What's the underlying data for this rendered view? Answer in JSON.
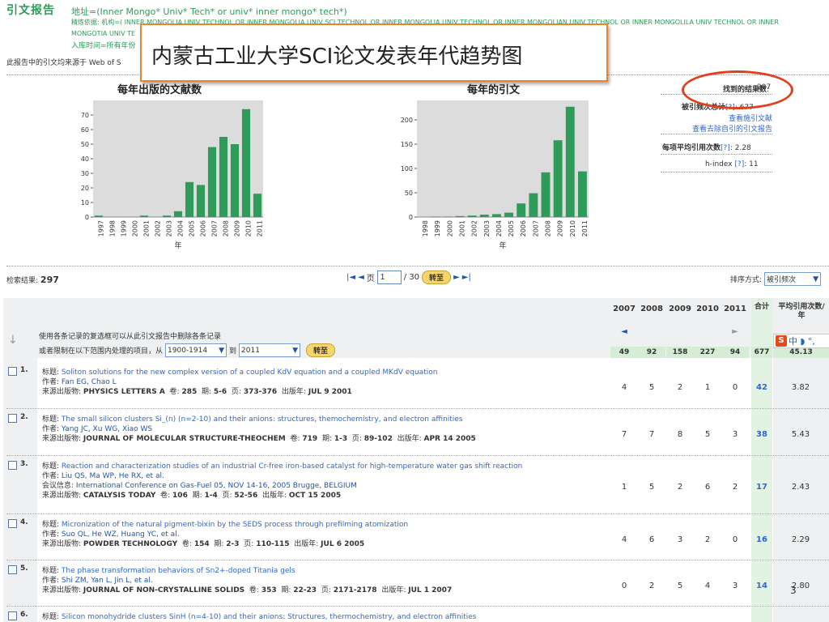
{
  "header": {
    "title": "引文报告",
    "query": "地址=(Inner Mongo* Univ* Tech* or univ* inner mongo* tech*)",
    "refine": "精炼依据: 机构=( INNER MONGOLIA UNIV TECHNOL OR INNER MONGOLIA UNIV SCI TECHNOL OR INNER MONGOLIA UNIV TECHNOL OR INNER MONGOLIAN UNIV TECHNOL OR INNER MONGOLILA UNIV TECHNOL OR INNER",
    "refine2": "MONGOTIA UNIV TE",
    "db": "入库时间=所有年份",
    "source": "此报告中的引文均来源于 Web of S"
  },
  "overlay": {
    "text": "内蒙古工业大学SCI论文发表年代趋势图"
  },
  "chart_data": [
    {
      "type": "bar",
      "title": "每年出版的文献数",
      "xlabel": "年",
      "ylabel": "",
      "categories": [
        "1997",
        "1998",
        "1999",
        "2000",
        "2001",
        "2002",
        "2003",
        "2004",
        "2005",
        "2006",
        "2007",
        "2008",
        "2009",
        "2010",
        "2011"
      ],
      "values": [
        1,
        0,
        0,
        0,
        1,
        0,
        1,
        4,
        24,
        22,
        48,
        55,
        50,
        74,
        16
      ],
      "ylim": [
        0,
        80
      ],
      "yticks": [
        0,
        10,
        20,
        30,
        40,
        50,
        60,
        70
      ],
      "grid": false,
      "color": "#2e9b5b"
    },
    {
      "type": "bar",
      "title": "每年的引文",
      "xlabel": "年",
      "ylabel": "",
      "categories": [
        "1998",
        "1999",
        "2000",
        "2001",
        "2002",
        "2003",
        "2004",
        "2005",
        "2006",
        "2007",
        "2008",
        "2009",
        "2010",
        "2011"
      ],
      "values": [
        0,
        1,
        1,
        2,
        3,
        5,
        6,
        9,
        28,
        49,
        92,
        158,
        227,
        94
      ],
      "ylim": [
        0,
        240
      ],
      "yticks": [
        0,
        50,
        100,
        150,
        200
      ],
      "grid": false,
      "color": "#2e9b5b"
    }
  ],
  "stats": {
    "found_label": "找到的结果数",
    "found_value": "297",
    "cited_label": "被引频次总计",
    "help": "[?]",
    "cited_value": "677",
    "view_citing": "查看施引文献",
    "view_no_self": "查看去除自引的引文报告",
    "avg_label": "每项平均引用次数",
    "avg_value": "2.28",
    "hindex_label": "h-index",
    "hindex_value": "11"
  },
  "toolbar": {
    "results_label": "检索结果:",
    "results_value": "297",
    "page_label": "页",
    "page_value": "1",
    "page_total": "/ 30",
    "go_label": "转至",
    "sort_label": "排序方式:",
    "sort_value": "被引频次"
  },
  "table": {
    "instruction1": "使用各条记录的复选框可以从此引文报告中删除各条记录",
    "instruction2_pre": "或者限制在以下范围内处理的项目，从",
    "range_from": "1900-1914",
    "range_to_label": "到",
    "range_to": "2011",
    "go_label": "转至",
    "years": [
      "2007",
      "2008",
      "2009",
      "2010",
      "2011"
    ],
    "total_label": "合计",
    "avg_label": "平均引用次数/年",
    "year_totals": [
      "49",
      "92",
      "158",
      "227",
      "94"
    ],
    "grand_total": "677",
    "grand_avg": "45.13",
    "prev_arrow": "◄",
    "next_arrow": "►"
  },
  "labels": {
    "title": "标题:",
    "author": "作者:",
    "source": "来源出版物:",
    "volume": "卷:",
    "issue": "期:",
    "pages": "页:",
    "date": "出版年:",
    "conference": "会议信息:"
  },
  "records": [
    {
      "num": "1.",
      "title": "Soliton solutions for the new complex version of a coupled KdV equation and a coupled MKdV equation",
      "authors": "Fan EG, Chao L",
      "journal": "PHYSICS LETTERS A",
      "volume": "285",
      "issue": "5-6",
      "pages": "373-376",
      "date": "JUL 9 2001",
      "cites": [
        "4",
        "5",
        "2",
        "1",
        "0"
      ],
      "total": "42",
      "avg": "3.82"
    },
    {
      "num": "2.",
      "title": "The small silicon clusters Si_(n) (n=2-10) and their anions: structures, themochemistry, and electron affinities",
      "authors": "Yang JC, Xu WG, Xiao WS",
      "journal": "JOURNAL OF MOLECULAR STRUCTURE-THEOCHEM",
      "volume": "719",
      "issue": "1-3",
      "pages": "89-102",
      "date": "APR 14 2005",
      "cites": [
        "7",
        "7",
        "8",
        "5",
        "3"
      ],
      "total": "38",
      "avg": "5.43"
    },
    {
      "num": "3.",
      "title": "Reaction and characterization studies of an industrial Cr-free iron-based catalyst for high-temperature water gas shift reaction",
      "authors": "Liu QS, Ma WP, He RX, et al.",
      "conference": "International Conference on Gas-Fuel 05, NOV 14-16, 2005 Brugge, BELGIUM",
      "journal": "CATALYSIS TODAY",
      "volume": "106",
      "issue": "1-4",
      "pages": "52-56",
      "date": "OCT 15 2005",
      "cites": [
        "1",
        "5",
        "2",
        "6",
        "2"
      ],
      "total": "17",
      "avg": "2.43"
    },
    {
      "num": "4.",
      "title": "Micronization of the natural pigment-bixin by the SEDS process through prefilming atomization",
      "authors": "Suo QL, He WZ, Huang YC, et al.",
      "journal": "POWDER TECHNOLOGY",
      "volume": "154",
      "issue": "2-3",
      "pages": "110-115",
      "date": "JUL 6 2005",
      "cites": [
        "4",
        "6",
        "3",
        "2",
        "0"
      ],
      "total": "16",
      "avg": "2.29"
    },
    {
      "num": "5.",
      "title": "The phase transformation behaviors of Sn2+-doped Titania gels",
      "authors": "Shi ZM, Yan L, Jin L, et al.",
      "journal": "JOURNAL OF NON-CRYSTALLINE SOLIDS",
      "volume": "353",
      "issue": "22-23",
      "pages": "2171-2178",
      "date": "JUL 1 2007",
      "cites": [
        "0",
        "2",
        "5",
        "4",
        "3"
      ],
      "total": "14",
      "avg": "2.80"
    },
    {
      "num": "6.",
      "title": "Silicon monohydride clusters SinH (n=4-10) and their anions: Structures, thermochemistry, and electron affinities"
    }
  ],
  "ime": {
    "logo": "S",
    "text": "中 ◗ °,"
  },
  "page_number": "3"
}
